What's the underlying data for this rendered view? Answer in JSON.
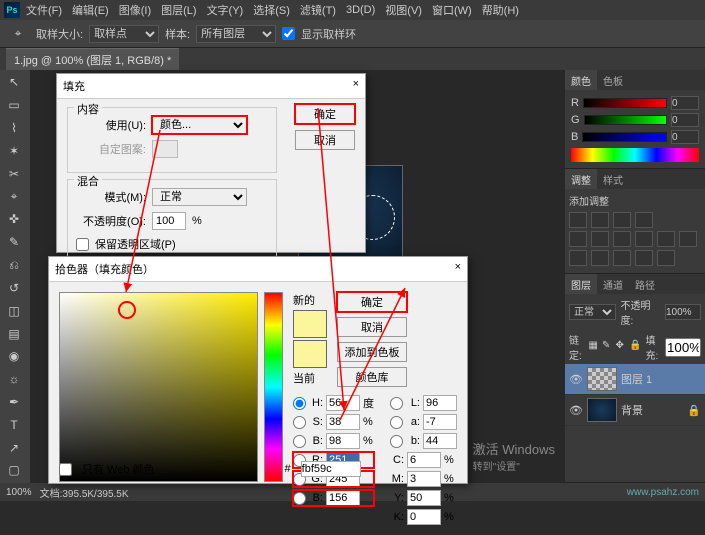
{
  "menu": {
    "file": "文件(F)",
    "edit": "编辑(E)",
    "image": "图像(I)",
    "layer": "图层(L)",
    "type": "文字(Y)",
    "select": "选择(S)",
    "filter": "滤镜(T)",
    "threeD": "3D(D)",
    "view": "视图(V)",
    "window": "窗口(W)",
    "help": "帮助(H)"
  },
  "opt": {
    "sampleSizeLbl": "取样大小:",
    "sampleSize": "取样点",
    "sampleLbl": "样本:",
    "sample": "所有图层",
    "showRing": "显示取样环"
  },
  "tab": {
    "title": "1.jpg @ 100% (图层 1, RGB/8) *"
  },
  "fill": {
    "title": "填充",
    "close": "×",
    "content": "内容",
    "useLbl": "使用(U):",
    "use": "颜色...",
    "autoPattern": "自定图案:",
    "blend": "混合",
    "modeLbl": "模式(M):",
    "mode": "正常",
    "opacityLbl": "不透明度(O):",
    "opacity": "100",
    "pct": "%",
    "preserve": "保留透明区域(P)",
    "ok": "确定",
    "cancel": "取消"
  },
  "picker": {
    "title": "拾色器（填充颜色）",
    "close": "×",
    "new": "新的",
    "current": "当前",
    "ok": "确定",
    "cancel": "取消",
    "addSwatch": "添加到色板",
    "libraries": "颜色库",
    "H": "56",
    "S": "38",
    "Bv": "98",
    "R": "251",
    "G": "245",
    "Bc": "156",
    "L": "96",
    "a": "-7",
    "b": "44",
    "C": "6",
    "M": "3",
    "Y": "50",
    "K": "0",
    "hex": "fbf59c",
    "webOnly": "只有 Web 颜色",
    "degree": "度",
    "pct": "%"
  },
  "panels": {
    "colorTab": "颜色",
    "swatchTab": "色板",
    "R": "R",
    "G": "G",
    "B": "B",
    "r": "0",
    "g": "0",
    "b": "0",
    "adjustTab": "调整",
    "styleTab": "样式",
    "addAdjust": "添加调整",
    "layersTab": "图层",
    "channelsTab": "通道",
    "pathsTab": "路径",
    "normal": "正常",
    "opacityLbl": "不透明度:",
    "opacity": "100%",
    "lockLbl": "链定:",
    "fillLbl": "填充:",
    "fill": "100%",
    "layer1": "图层 1",
    "background": "背景"
  },
  "status": {
    "zoom": "100%",
    "docsize": "文档:395.5K/395.5K"
  },
  "watermark": {
    "l1": "激活 Windows",
    "l2": "转到\"设置\""
  },
  "brand": "www.psahz.com"
}
